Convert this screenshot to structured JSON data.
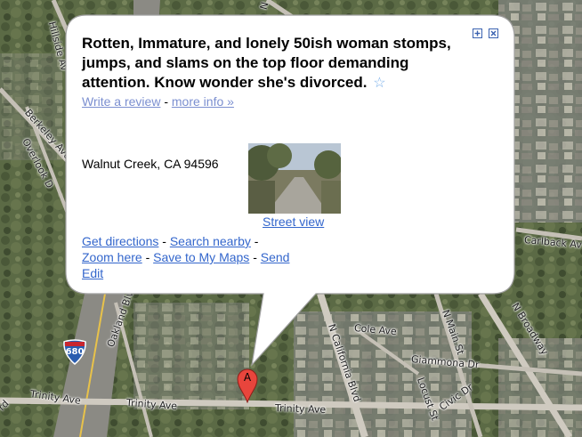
{
  "map": {
    "road_labels": [
      "Hillside Av",
      "N C",
      "Berkeley Ave",
      "Overlook D",
      "Carlback Av",
      "Oakland Blvd",
      "Cole Ave",
      "N Main St",
      "N Broadway",
      "N California Blvd",
      "Giammona Dr",
      "Locust St",
      "Civic Dr",
      "Trinity Ave",
      "Trinity Ave",
      "Trinity Ave",
      "rd"
    ],
    "highway_shield": "680",
    "marker_letter": "A"
  },
  "info_window": {
    "title": "Rotten, Immature, and lonely 50ish woman stomps, jumps, and slams on the top floor demanding attention. Know wonder she's divorced.",
    "star_icon": "star-outline",
    "write_review": "Write a review",
    "separator": "-",
    "more_info": "more info »",
    "address": "Walnut Creek, CA 94596",
    "street_view": "Street view",
    "get_directions": "Get directions",
    "search_nearby": "Search nearby",
    "zoom_here": "Zoom here",
    "save_to_maps": "Save to My Maps",
    "send": "Send",
    "edit": "Edit"
  },
  "colors": {
    "link": "#3366cc",
    "bubble_border": "#a0a0a0",
    "marker": "#e8453c"
  }
}
